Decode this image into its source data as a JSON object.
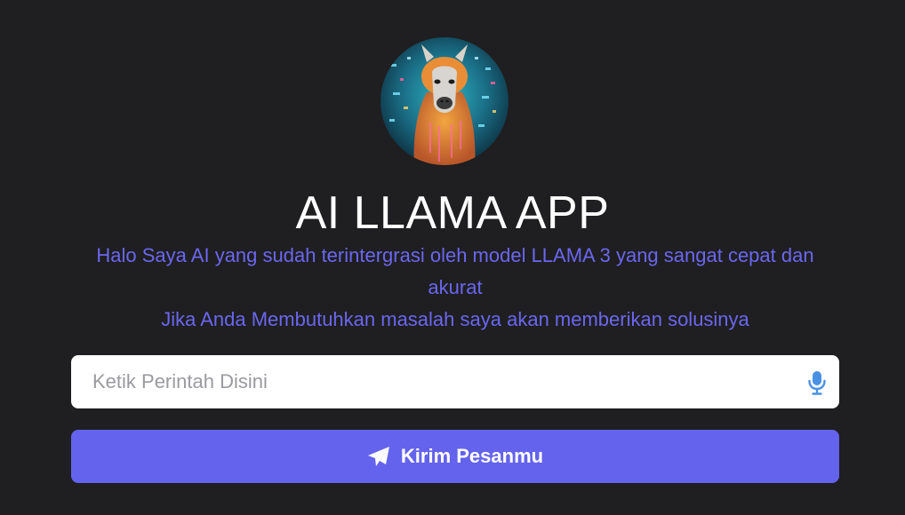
{
  "app": {
    "title": "AI LLAMA APP",
    "description_line1": "Halo Saya AI yang sudah terintergrasi oleh model LLAMA 3 yang sangat cepat dan akurat",
    "description_line2": "Jika Anda Membutuhkan masalah saya akan memberikan solusinya",
    "avatar_icon": "llama-avatar"
  },
  "prompt": {
    "value": "",
    "placeholder": "Ketik Perintah Disini",
    "mic_icon": "microphone-icon"
  },
  "send_button": {
    "label": "Kirim Pesanmu",
    "icon": "paper-plane-icon"
  },
  "colors": {
    "background": "#1f1e20",
    "accent": "#6463ed",
    "description_text": "#6a67f0",
    "mic": "#4a90e2"
  }
}
